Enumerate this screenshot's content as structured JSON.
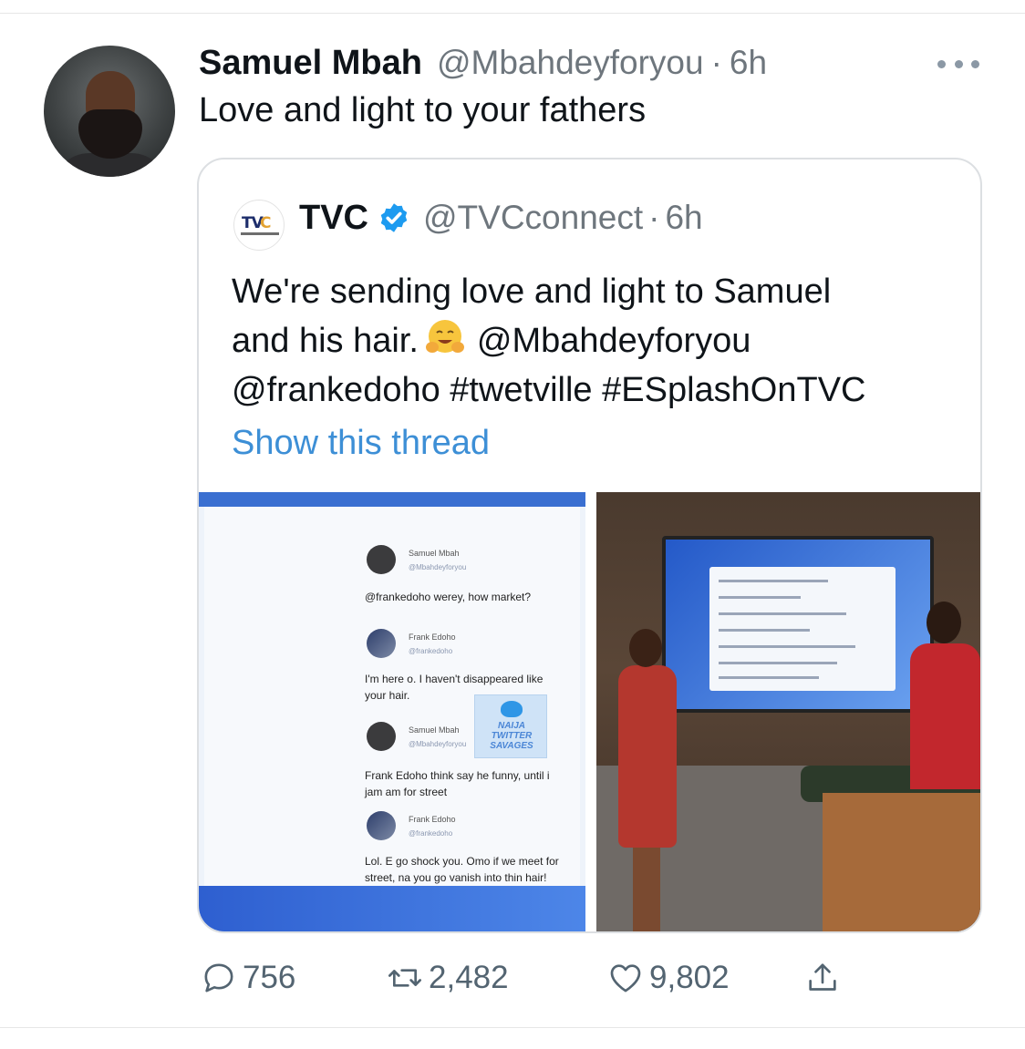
{
  "tweet": {
    "author_name": "Samuel Mbah",
    "author_handle": "@Mbahdeyforyou",
    "separator": "·",
    "time": "6h",
    "text": "Love and light to your fathers"
  },
  "quote": {
    "name": "TVC",
    "handle": "@TVCconnect",
    "separator": "·",
    "time": "6h",
    "logo_text_tv": "TV",
    "logo_text_c": "C",
    "body_line1": "We're sending love and light to Samuel",
    "body_line2_a": "and his hair.",
    "body_line2_b": "@Mbahdeyforyou",
    "body_line3": "@frankedoho #twetville #ESplashOnTVC",
    "show_thread": "Show this thread",
    "emoji": "hugging-face-emoji"
  },
  "media_left": {
    "t1_name": "Samuel Mbah",
    "t1_handle": "@Mbahdeyforyou",
    "t1_mention": "@frankedoho",
    "t1_text": " werey, how market?",
    "t2_name": "Frank Edoho",
    "t2_handle": "@frankedoho",
    "t2_line1": "I'm here o.  I haven't disappeared like",
    "t2_line2": "your hair.",
    "t3_name": "Samuel Mbah",
    "t3_handle": "@Mbahdeyforyou",
    "t3_line1": "Frank Edoho think say he funny, until i",
    "t3_line2": "jam am for street",
    "t4_name": "Frank Edoho",
    "t4_handle": "@frankedoho",
    "t4_line1": "Lol. E go shock you. Omo if we meet for",
    "t4_line2": "street, na you go vanish into thin hair!",
    "badge_line1": "NAIJA",
    "badge_line2": "TWITTER",
    "badge_line3": "SAVAGES"
  },
  "actions": {
    "reply_count": "756",
    "retweet_count": "2,482",
    "like_count": "9,802"
  },
  "icons": {
    "more": "more-dots-icon",
    "verified": "verified-badge-icon",
    "reply": "reply-bubble-icon",
    "retweet": "retweet-icon",
    "like": "heart-icon",
    "share": "share-icon"
  },
  "colors": {
    "link": "#3d8fd6",
    "secondary_text": "#6e767d",
    "verified": "#1d9bf0",
    "action_icon": "#536471"
  }
}
